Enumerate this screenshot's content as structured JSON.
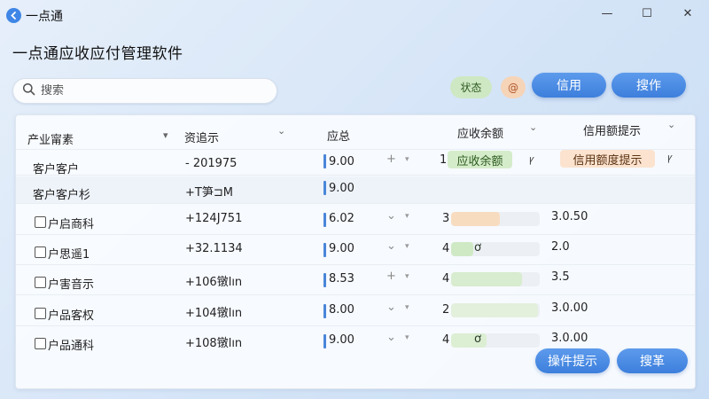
{
  "window": {
    "title": "一点通",
    "minimize_glyph": "—",
    "maximize_glyph": "☐",
    "close_glyph": "✕"
  },
  "heading": "一点通应收应付管理软件",
  "search": {
    "placeholder": "搜索"
  },
  "toolbar": {
    "status_chip": "状态",
    "at_chip": "@",
    "credit_button": "信用",
    "operate_button": "搜作"
  },
  "table": {
    "headers": {
      "customer": "产业甯素",
      "info": "资追示",
      "total": "应总",
      "balance": "应收余额",
      "credit": "信用额提示"
    },
    "header_arrows": {
      "customer": "▾",
      "info": "⌄",
      "balance": "⌄",
      "credit": "⌄"
    },
    "row0": {
      "customer": "客户客户",
      "info": "- 201975",
      "amount": "9.00",
      "plus": "+",
      "tri": "▾",
      "num": "1",
      "balance_tag": "应收余额",
      "bal_icon": "ꝩ",
      "credit_tag": "信用额度提示",
      "credit_icon": "ꝩ"
    },
    "row1": {
      "customer": "客户客户杉",
      "info": "+T笋⊐M",
      "amount": "9.00"
    },
    "rows": [
      {
        "customer": "户启商科",
        "info": "+124J751",
        "amount": "6.02",
        "action": "chevron",
        "action_glyph": "⌄",
        "tri": "▾",
        "num": "3",
        "progress": 0.55,
        "progress_color": "#f8dcc0",
        "mark": "",
        "credit": "3.0.50"
      },
      {
        "customer": "户思遥1",
        "info": "+32.1134",
        "amount": "9.00",
        "action": "chevron",
        "action_glyph": "⌄",
        "tri": "▾",
        "num": "4",
        "progress": 0.25,
        "progress_color": "#cfe9c5",
        "mark": "ơ",
        "credit": "2.0"
      },
      {
        "customer": "户害音示",
        "info": "+106镦lın",
        "amount": "8.53",
        "action": "plus",
        "action_glyph": "+",
        "tri": "▾",
        "num": "4",
        "progress": 0.8,
        "progress_color": "#d8eccf",
        "mark": "",
        "credit": "3.5"
      },
      {
        "customer": "户品客权",
        "info": "+104镦lın",
        "amount": "8.00",
        "action": "chevron",
        "action_glyph": "⌄",
        "tri": "▾",
        "num": "2",
        "progress": 0.98,
        "progress_color": "#e3f0dc",
        "mark": "",
        "credit": "3.0.00"
      },
      {
        "customer": "户品通科",
        "info": "+108镦lın",
        "amount": "9.00",
        "action": "chevron",
        "action_glyph": "⌄",
        "tri": "▾",
        "num": "4",
        "progress": 0.4,
        "progress_color": "#dcefd3",
        "mark": "ơ",
        "credit": "3.0.00"
      }
    ]
  },
  "footer": {
    "tip_button": "操件提示",
    "search_button": "搜革"
  },
  "colors": {
    "accent": "#3c7fdc",
    "status_chip_bg": "#cfe8c4",
    "at_chip_bg": "#f6d4b8",
    "balance_tag_bg": "#d5ecca",
    "credit_tag_bg": "#fbe3cf"
  },
  "icons": {
    "app": "app-logo-icon",
    "search": "search-icon",
    "minimize": "minimize-icon",
    "maximize": "maximize-icon",
    "close": "close-icon"
  }
}
